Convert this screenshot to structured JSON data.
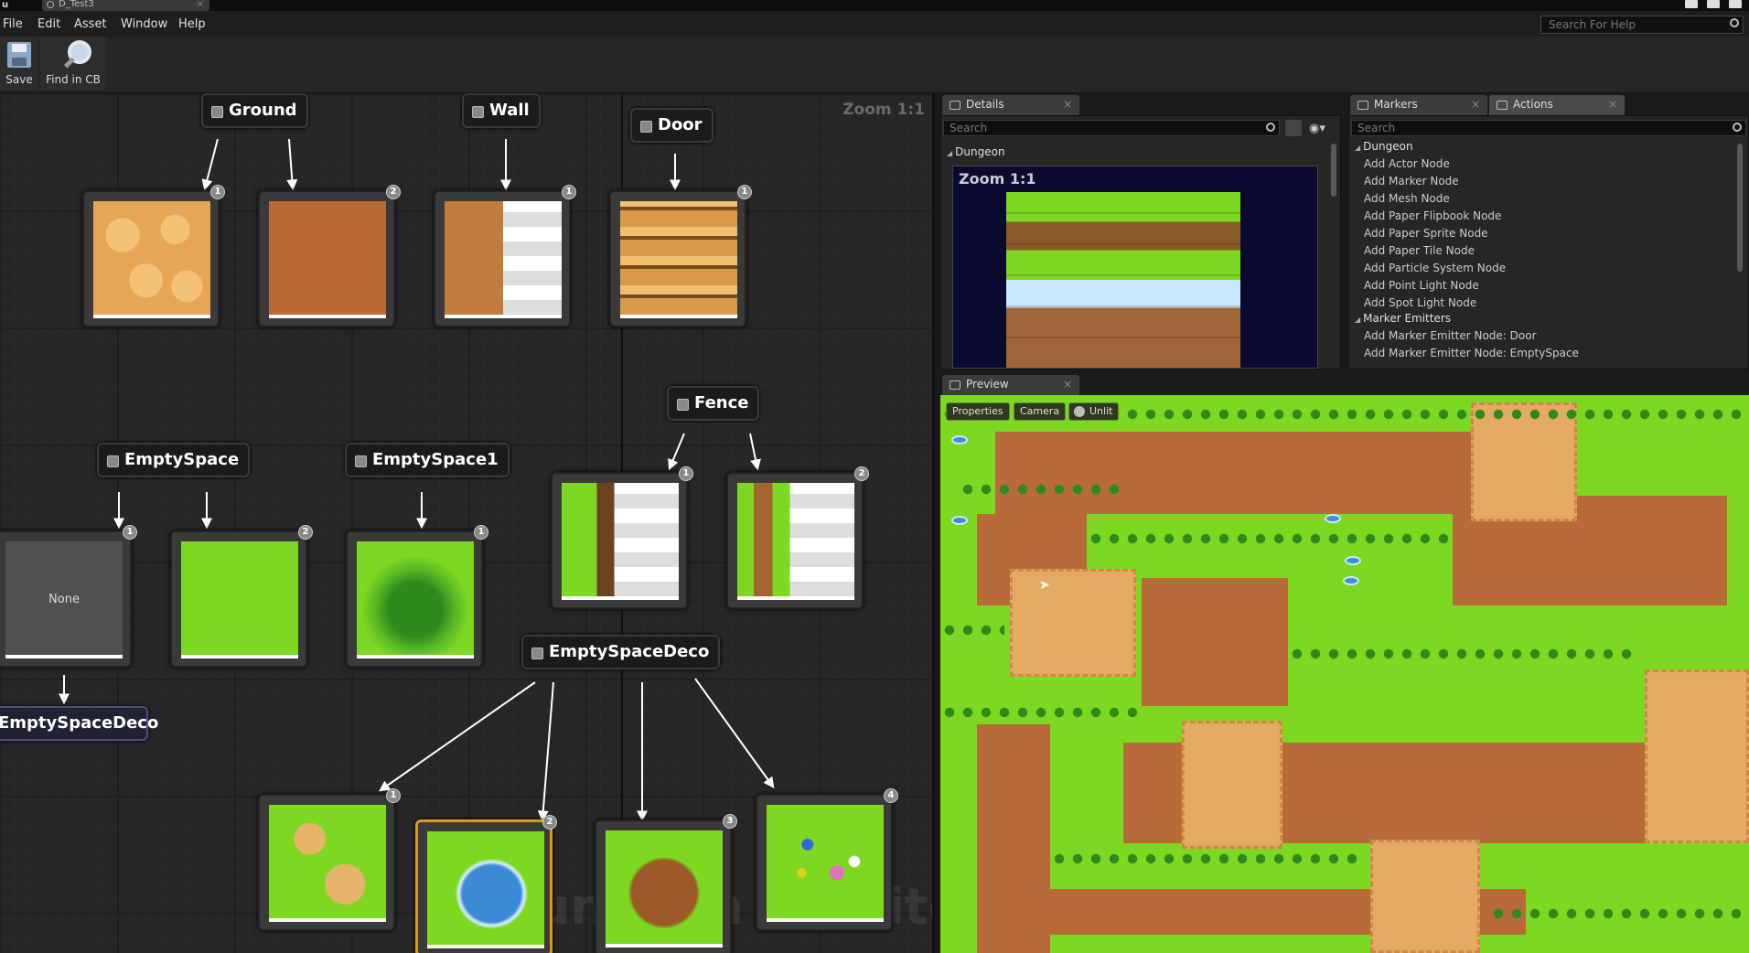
{
  "window": {
    "tab_title": "D_Test3",
    "logo": "u"
  },
  "menu": [
    "File",
    "Edit",
    "Asset",
    "Window",
    "Help"
  ],
  "help_search": {
    "placeholder": "Search For Help"
  },
  "toolbar": {
    "save_label": "Save",
    "find_label": "Find in CB"
  },
  "graph": {
    "zoom": "Zoom 1:1",
    "watermark": "Dungeon Architect",
    "marker_nodes": {
      "ground": "Ground",
      "wall": "Wall",
      "door": "Door",
      "fence": "Fence",
      "empty_space": "EmptySpace",
      "empty_space1": "EmptySpace1",
      "empty_space_deco": "EmptySpaceDeco",
      "empty_space_deco_emitter": "EmptySpaceDeco"
    },
    "visual_nodes": {
      "ground1": {
        "badge": "1"
      },
      "ground2": {
        "badge": "2"
      },
      "wall1": {
        "badge": "1"
      },
      "door1": {
        "badge": "1"
      },
      "none1": {
        "badge": "1",
        "label": "None"
      },
      "grass2": {
        "badge": "2"
      },
      "bush1": {
        "badge": "1"
      },
      "fence1": {
        "badge": "1"
      },
      "fence2": {
        "badge": "2"
      },
      "deco1": {
        "badge": "1"
      },
      "deco2": {
        "badge": "2"
      },
      "deco3": {
        "badge": "3"
      },
      "deco4": {
        "badge": "4"
      }
    }
  },
  "details": {
    "tab": "Details",
    "search_placeholder": "Search",
    "category": "Dungeon",
    "zoom": "Zoom 1:1"
  },
  "markers_tab": "Markers",
  "actions": {
    "tab": "Actions",
    "search_placeholder": "Search",
    "categories": [
      {
        "name": "Dungeon",
        "items": [
          "Add Actor Node",
          "Add Marker Node",
          "Add Mesh Node",
          "Add Paper Flipbook Node",
          "Add Paper Sprite Node",
          "Add Paper Tile Node",
          "Add Particle System Node",
          "Add Point Light Node",
          "Add Spot Light Node"
        ]
      },
      {
        "name": "Marker Emitters",
        "items": [
          "Add Marker Emitter Node: Door",
          "Add Marker Emitter Node: EmptySpace"
        ]
      }
    ]
  },
  "preview": {
    "tab": "Preview",
    "buttons": [
      "Properties",
      "Camera",
      "Unlit"
    ]
  },
  "colors": {
    "grass": "#7cd820",
    "dirt": "#b86a38",
    "sand": "#e5aa62",
    "highlight": "#d89a1a"
  }
}
